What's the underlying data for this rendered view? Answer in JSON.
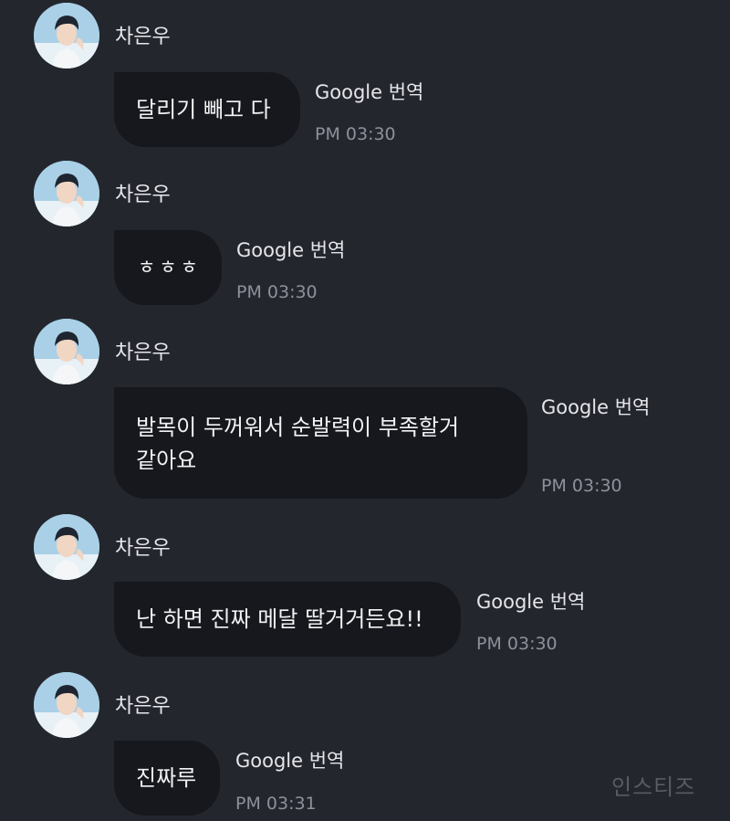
{
  "messages": [
    {
      "sender": "차은우",
      "text": "달리기 빼고 다",
      "translate_label": "Google 번역",
      "time": "PM 03:30"
    },
    {
      "sender": "차은우",
      "text": "ㅎㅎㅎ",
      "translate_label": "Google 번역",
      "time": "PM 03:30"
    },
    {
      "sender": "차은우",
      "text_line1": "발목이 두꺼워서 순발력이 부족할거",
      "text_line2": "같아요",
      "translate_label": "Google 번역",
      "time": "PM 03:30"
    },
    {
      "sender": "차은우",
      "text": "난 하면 진짜 메달 딸거거든요!!",
      "translate_label": "Google 번역",
      "time": "PM 03:30"
    },
    {
      "sender": "차은우",
      "text": "진짜루",
      "translate_label": "Google 번역",
      "time": "PM 03:31"
    }
  ],
  "watermark": "인스티즈",
  "colors": {
    "background": "#24262e",
    "bubble": "#17181d",
    "time": "#8f909b"
  },
  "icons": {
    "avatar": "profile-photo-avatar"
  }
}
